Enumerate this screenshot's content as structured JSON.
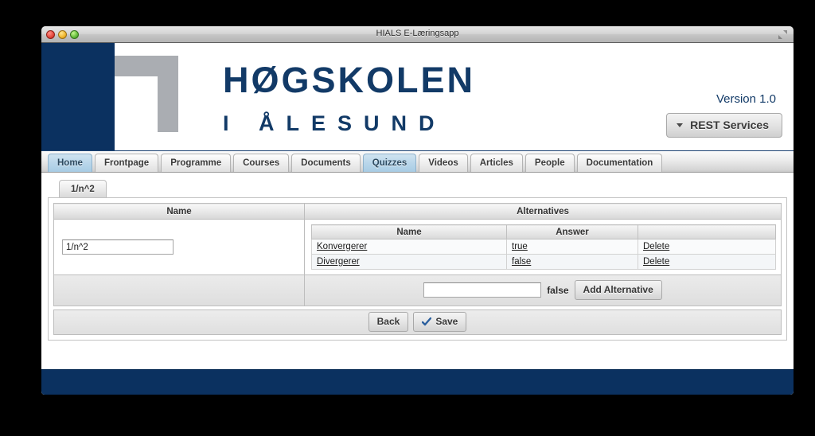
{
  "window": {
    "title": "HIALS E-Læringsapp",
    "controls": {
      "close": "close-button",
      "minimize": "minimize-button",
      "zoom": "zoom-button"
    },
    "resize_icon": "resize-icon"
  },
  "colors": {
    "brand_navy": "#0b3160",
    "brand_text": "#123a67",
    "logo_gray": "#aaadb2",
    "tab_active": "#b9d6ea",
    "check_blue": "#2b5f9e"
  },
  "header": {
    "logo_mark": "hials-corner-logo",
    "wordmark_line1": "HØGSKOLEN",
    "wordmark_line2": "I ÅLESUND",
    "version": "Version 1.0",
    "rest_services_label": "REST Services",
    "rest_services_caret": "caret-down-icon"
  },
  "nav": {
    "tabs": [
      {
        "label": "Home",
        "active": true
      },
      {
        "label": "Frontpage",
        "active": false
      },
      {
        "label": "Programme",
        "active": false
      },
      {
        "label": "Courses",
        "active": false
      },
      {
        "label": "Documents",
        "active": false
      },
      {
        "label": "Quizzes",
        "active": true
      },
      {
        "label": "Videos",
        "active": false
      },
      {
        "label": "Articles",
        "active": false
      },
      {
        "label": "People",
        "active": false
      },
      {
        "label": "Documentation",
        "active": false
      }
    ]
  },
  "subtabs": [
    {
      "label": "1/n^2",
      "active": true
    }
  ],
  "quiz_table": {
    "headers": {
      "name": "Name",
      "alternatives": "Alternatives"
    },
    "quiz_name_value": "1/n^2",
    "quiz_name_placeholder": ""
  },
  "alternatives_table": {
    "headers": {
      "name": "Name",
      "answer": "Answer",
      "actions": ""
    },
    "rows": [
      {
        "name": "Konvergerer",
        "answer": "true",
        "action": "Delete"
      },
      {
        "name": "Divergerer",
        "answer": "false",
        "action": "Delete"
      }
    ]
  },
  "add_alternative": {
    "input_value": "",
    "input_placeholder": "",
    "answer_value": "false",
    "button_label": "Add Alternative"
  },
  "actions": {
    "back_label": "Back",
    "save_label": "Save",
    "save_icon": "checkmark-icon"
  }
}
